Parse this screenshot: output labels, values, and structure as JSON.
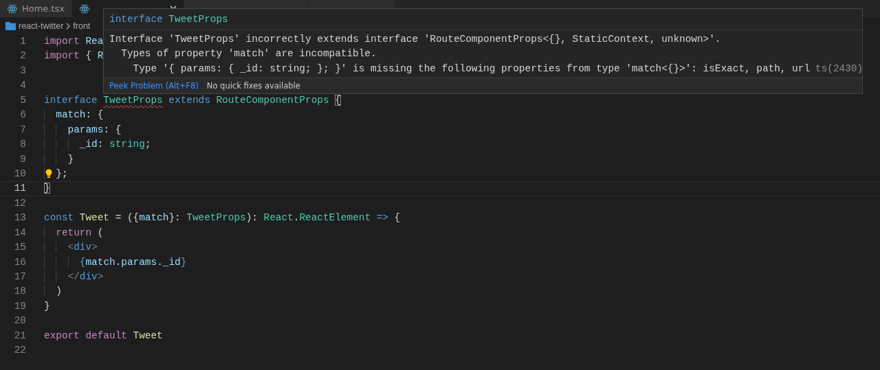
{
  "tabs": [
    {
      "label": "Home.tsx",
      "kind": "react",
      "selected": false
    },
    {
      "kind": "react",
      "selected": true
    },
    {
      "kind": "blank",
      "selected": false
    },
    {
      "kind": "blank",
      "selected": false
    }
  ],
  "breadcrumb": {
    "items": [
      "react-twitter",
      "front"
    ]
  },
  "editor": {
    "lines": [
      {
        "number": "1",
        "current": false,
        "lightbulb": false,
        "tokens": [
          {
            "text": "import ",
            "kind": "control"
          },
          {
            "text": "Rea",
            "kind": "var"
          }
        ]
      },
      {
        "number": "2",
        "current": false,
        "lightbulb": false,
        "tokens": [
          {
            "text": "import ",
            "kind": "control"
          },
          {
            "text": "{ ",
            "kind": "punct"
          },
          {
            "text": "R",
            "kind": "var"
          }
        ]
      },
      {
        "number": "3",
        "current": false,
        "lightbulb": false
      },
      {
        "number": "4",
        "current": false,
        "lightbulb": false
      },
      {
        "number": "5",
        "current": false,
        "lightbulb": false,
        "tokens": [
          {
            "text": "interface ",
            "kind": "keyword"
          },
          {
            "text": "TweetProps",
            "kind": "type-error"
          },
          {
            "text": " extends ",
            "kind": "keyword"
          },
          {
            "text": "RouteComponentProps ",
            "kind": "type"
          },
          {
            "text": "{",
            "kind": "bracket-match"
          }
        ]
      },
      {
        "number": "6",
        "current": false,
        "lightbulb": false,
        "tokens": [
          {
            "text": "  match",
            "kind": "var"
          },
          {
            "text": ": {",
            "kind": "punct"
          }
        ]
      },
      {
        "number": "7",
        "current": false,
        "lightbulb": false,
        "tokens": [
          {
            "text": "    params",
            "kind": "var"
          },
          {
            "text": ": {",
            "kind": "punct"
          }
        ]
      },
      {
        "number": "8",
        "current": false,
        "lightbulb": false,
        "tokens": [
          {
            "text": "      _id",
            "kind": "var"
          },
          {
            "text": ": ",
            "kind": "punct"
          },
          {
            "text": "string",
            "kind": "type"
          },
          {
            "text": ";",
            "kind": "punct"
          }
        ]
      },
      {
        "number": "9",
        "current": false,
        "lightbulb": false,
        "tokens": [
          {
            "text": "    }",
            "kind": "punct"
          }
        ]
      },
      {
        "number": "10",
        "current": false,
        "lightbulb": true,
        "tokens": [
          {
            "text": "  };",
            "kind": "punct"
          }
        ]
      },
      {
        "number": "11",
        "current": true,
        "lightbulb": false,
        "tokens": [
          {
            "text": "}",
            "kind": "bracket-match"
          }
        ]
      },
      {
        "number": "12",
        "current": false,
        "lightbulb": false
      },
      {
        "number": "13",
        "current": false,
        "lightbulb": false,
        "tokens": [
          {
            "text": "const ",
            "kind": "keyword"
          },
          {
            "text": "Tweet",
            "kind": "func"
          },
          {
            "text": " = ({",
            "kind": "punct"
          },
          {
            "text": "match",
            "kind": "var"
          },
          {
            "text": "}: ",
            "kind": "punct"
          },
          {
            "text": "TweetProps",
            "kind": "type"
          },
          {
            "text": "): ",
            "kind": "punct"
          },
          {
            "text": "React",
            "kind": "type"
          },
          {
            "text": ".",
            "kind": "punct"
          },
          {
            "text": "ReactElement",
            "kind": "type"
          },
          {
            "text": " => ",
            "kind": "keyword"
          },
          {
            "text": "{",
            "kind": "punct"
          }
        ]
      },
      {
        "number": "14",
        "current": false,
        "lightbulb": false,
        "tokens": [
          {
            "text": "  return",
            "kind": "control"
          },
          {
            "text": " (",
            "kind": "punct"
          }
        ]
      },
      {
        "number": "15",
        "current": false,
        "lightbulb": false,
        "tokens": [
          {
            "text": "    <",
            "kind": "tag-bracket"
          },
          {
            "text": "div",
            "kind": "keyword"
          },
          {
            "text": ">",
            "kind": "tag-bracket"
          }
        ]
      },
      {
        "number": "16",
        "current": false,
        "lightbulb": false,
        "tokens": [
          {
            "text": "      {",
            "kind": "keyword"
          },
          {
            "text": "match",
            "kind": "var"
          },
          {
            "text": ".",
            "kind": "punct"
          },
          {
            "text": "params",
            "kind": "var"
          },
          {
            "text": ".",
            "kind": "punct"
          },
          {
            "text": "_id",
            "kind": "var"
          },
          {
            "text": "}",
            "kind": "keyword"
          }
        ]
      },
      {
        "number": "17",
        "current": false,
        "lightbulb": false,
        "tokens": [
          {
            "text": "    </",
            "kind": "tag-bracket"
          },
          {
            "text": "div",
            "kind": "keyword"
          },
          {
            "text": ">",
            "kind": "tag-bracket"
          }
        ]
      },
      {
        "number": "18",
        "current": false,
        "lightbulb": false,
        "tokens": [
          {
            "text": "  )",
            "kind": "punct"
          }
        ]
      },
      {
        "number": "19",
        "current": false,
        "lightbulb": false,
        "tokens": [
          {
            "text": "}",
            "kind": "punct"
          }
        ]
      },
      {
        "number": "20",
        "current": false,
        "lightbulb": false
      },
      {
        "number": "21",
        "current": false,
        "lightbulb": false,
        "tokens": [
          {
            "text": "export default ",
            "kind": "control"
          },
          {
            "text": "Tweet",
            "kind": "func"
          }
        ]
      },
      {
        "number": "22",
        "current": false,
        "lightbulb": false
      }
    ]
  },
  "hover": {
    "title": [
      {
        "text": "interface ",
        "kind": "keyword"
      },
      {
        "text": "TweetProps",
        "kind": "type"
      }
    ],
    "message": [
      "Interface 'TweetProps' incorrectly extends interface 'RouteComponentProps<{}, StaticContext, unknown>'.",
      "  Types of property 'match' are incompatible.",
      "    Type '{ params: { _id: string; }; }' is missing the following properties from type 'match<{}>': isExact, path, url"
    ],
    "code": "ts(2430)",
    "peek_link": "Peek Problem (Alt+F8)",
    "quick_fix_note": "No quick fixes available"
  }
}
